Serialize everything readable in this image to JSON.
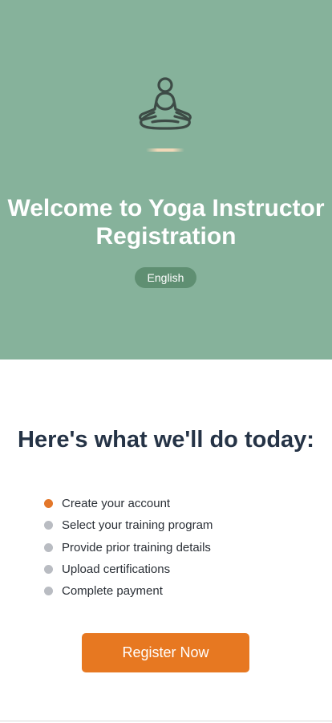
{
  "hero": {
    "icon": "meditation-icon",
    "title": "Welcome to Yoga Instructor Registration",
    "language_label": "English",
    "colors": {
      "background": "#86b29b",
      "pill": "#5f8f72"
    }
  },
  "intro": {
    "heading": "Here's what we'll do today:",
    "steps": [
      {
        "label": "Create your account",
        "status": "active"
      },
      {
        "label": "Select your training program",
        "status": "pending"
      },
      {
        "label": "Provide prior training details",
        "status": "pending"
      },
      {
        "label": "Upload certifications",
        "status": "pending"
      },
      {
        "label": "Complete payment",
        "status": "pending"
      }
    ]
  },
  "actions": {
    "register_label": "Register Now",
    "accent_color": "#e77821"
  }
}
